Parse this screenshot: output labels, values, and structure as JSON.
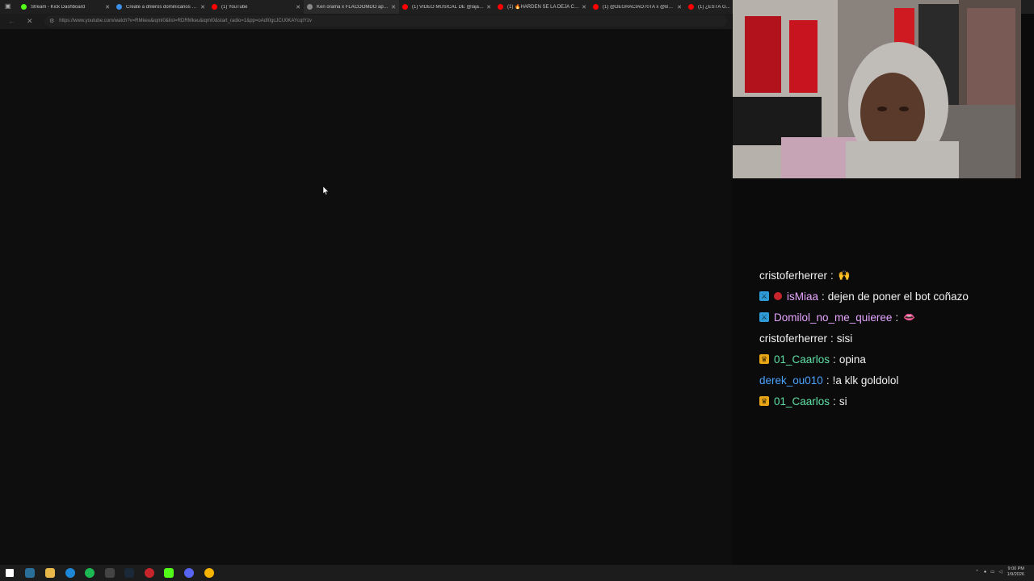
{
  "browser": {
    "tabs": [
      {
        "label": "Stream - Kick Dashboard",
        "color": "#53fc18",
        "active": false
      },
      {
        "label": "Create a drileros dominicanos 20...",
        "color": "#3a8fe8",
        "active": false
      },
      {
        "label": "(1) YouTube",
        "color": "#ff0000",
        "active": false
      },
      {
        "label": "Ken orama x FLACOOMDO apar...",
        "color": "#888888",
        "active": true
      },
      {
        "label": "(1) VIDEO MUSICAL DE @lajaOfic...",
        "color": "#ff0000",
        "active": false
      },
      {
        "label": "(1) 🔥HARDEN SE LA DEJA CAER ...",
        "color": "#ff0000",
        "active": false
      },
      {
        "label": "(1) @DEGRACIAO70TA x @BLIZZ...",
        "color": "#ff0000",
        "active": false
      },
      {
        "label": "(1) ¿ESTÁ G...",
        "color": "#ff0000",
        "active": false
      }
    ],
    "url": "https://www.youtube.com/watch?v=RMkeu&iqmI0&list=RDRMkeu&iqmI0&start_radio=1&pp=oAdI0gcJCU0KAYcqIYzv"
  },
  "chat": {
    "messages": [
      {
        "badges": [],
        "user": "cristoferherrer",
        "user_color": "#f2f2f2",
        "text": "",
        "emote": "🙌"
      },
      {
        "badges": [
          "sword",
          "dot"
        ],
        "user": "isMiaa",
        "user_color": "#e6a6ff",
        "text": "dejen de poner el bot coñazo",
        "emote": ""
      },
      {
        "badges": [
          "sword"
        ],
        "user": "Domilol_no_me_quieree",
        "user_color": "#e6a6ff",
        "text": "",
        "emote": "👄"
      },
      {
        "badges": [],
        "user": "cristoferherrer",
        "user_color": "#f2f2f2",
        "text": "sisi",
        "emote": ""
      },
      {
        "badges": [
          "crown"
        ],
        "user": "01_Caarlos",
        "user_color": "#5fe0a6",
        "text": "opina",
        "emote": ""
      },
      {
        "badges": [],
        "user": "derek_ou010",
        "user_color": "#4aa3ff",
        "text": "!a klk goldolol",
        "emote": ""
      },
      {
        "badges": [
          "crown"
        ],
        "user": "01_Caarlos",
        "user_color": "#5fe0a6",
        "text": "si",
        "emote": ""
      }
    ]
  },
  "taskbar": {
    "time": "9:00 PM",
    "date": "1/9/2026"
  }
}
